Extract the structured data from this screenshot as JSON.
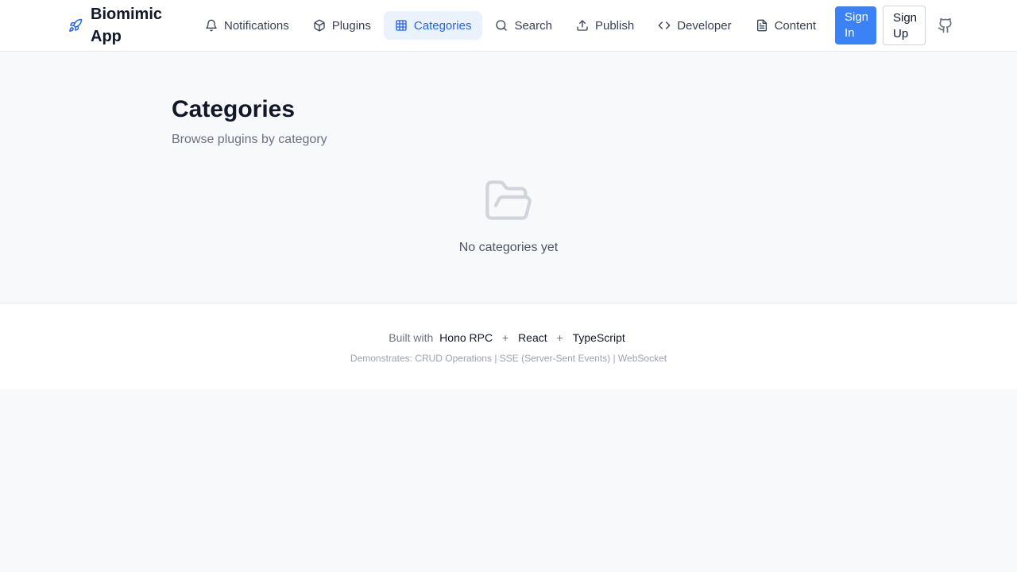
{
  "brand": {
    "name": "Biomimic App"
  },
  "nav": [
    {
      "label": "Notifications",
      "icon": "bell-icon"
    },
    {
      "label": "Plugins",
      "icon": "box-icon"
    },
    {
      "label": "Categories",
      "icon": "grid-icon",
      "active": true
    },
    {
      "label": "Search",
      "icon": "search-icon"
    },
    {
      "label": "Publish",
      "icon": "upload-icon"
    },
    {
      "label": "Developer",
      "icon": "code-icon"
    },
    {
      "label": "Content",
      "icon": "file-icon"
    }
  ],
  "auth": {
    "sign_in": "Sign In",
    "sign_up": "Sign Up"
  },
  "main": {
    "title": "Categories",
    "subtitle": "Browse plugins by category",
    "empty_text": "No categories yet"
  },
  "footer": {
    "built_with": "Built with",
    "tech1": "Hono RPC",
    "plus1": "+",
    "tech2": "React",
    "plus2": "+",
    "tech3": "TypeScript",
    "demonstrates": "Demonstrates: CRUD Operations | SSE (Server-Sent Events) | WebSocket"
  },
  "colors": {
    "accent": "#3b82f6",
    "active_bg": "#eaf2fd",
    "active_text": "#2563eb"
  }
}
